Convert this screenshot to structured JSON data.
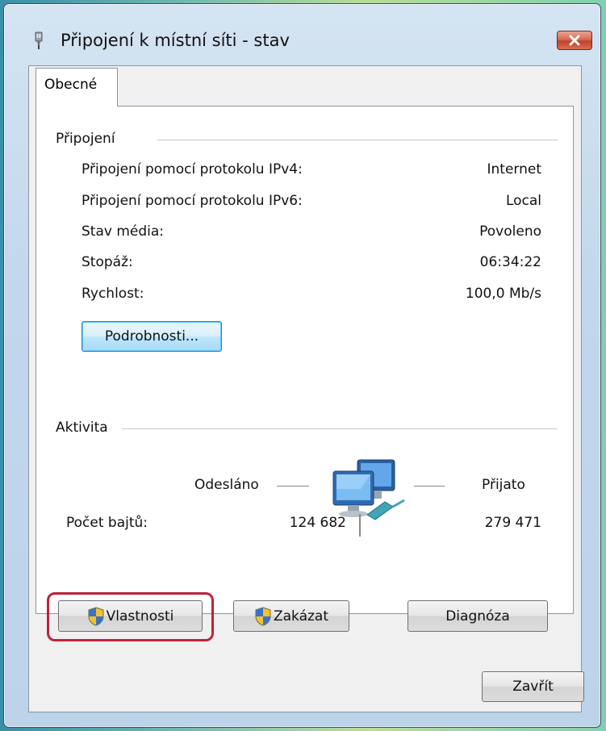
{
  "window": {
    "title": "Připojení k místní síti - stav"
  },
  "tabs": [
    {
      "label": "Obecné"
    }
  ],
  "connection": {
    "group_title": "Připojení",
    "rows": [
      {
        "label": "Připojení pomocí protokolu IPv4:",
        "value": "Internet"
      },
      {
        "label": "Připojení pomocí protokolu IPv6:",
        "value": "Local"
      },
      {
        "label": "Stav média:",
        "value": "Povoleno"
      },
      {
        "label": "Stopáž:",
        "value": "06:34:22"
      },
      {
        "label": "Rychlost:",
        "value": "100,0 Mb/s"
      }
    ],
    "details_button": "Podrobnosti..."
  },
  "activity": {
    "group_title": "Aktivita",
    "sent_label": "Odesláno",
    "received_label": "Přijato",
    "bytes_label": "Počet bajtů:",
    "bytes_sent": "124 682",
    "bytes_received": "279 471",
    "icon": "network-computers-icon"
  },
  "actions": {
    "properties": "Vlastnosti",
    "disable": "Zakázat",
    "diagnose": "Diagnóza",
    "close": "Zavřít"
  },
  "colors": {
    "highlight": "#c0223a",
    "close_button": "#c2402a"
  }
}
